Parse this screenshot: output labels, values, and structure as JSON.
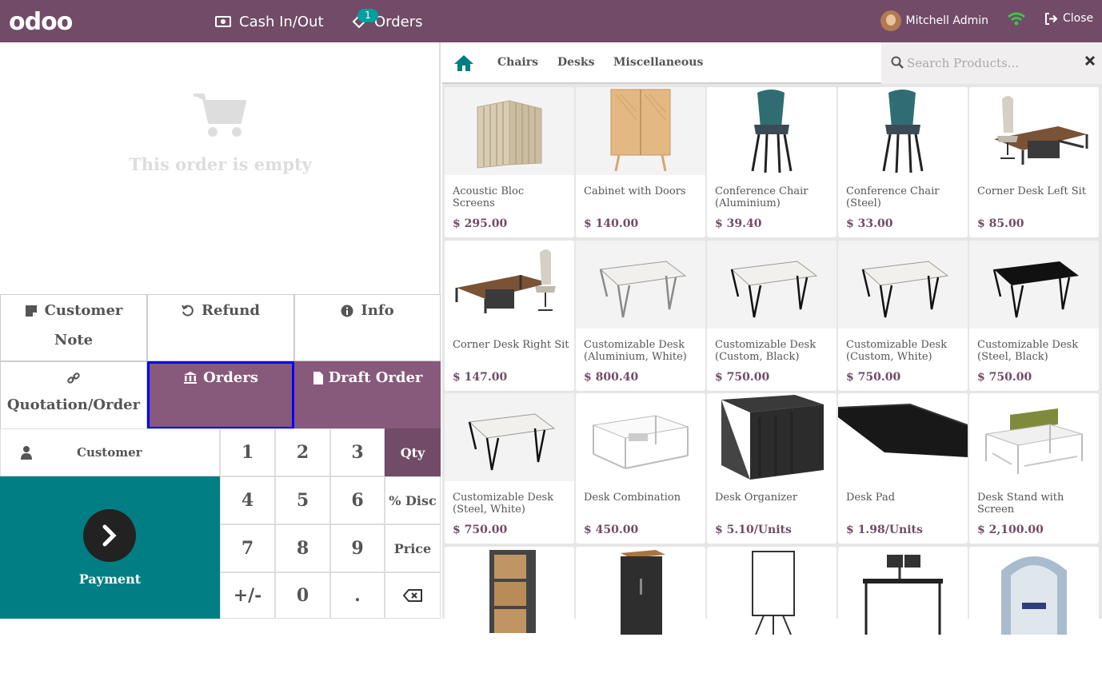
{
  "topbar": {
    "logo": "odoo",
    "cash_inout": "Cash In/Out",
    "orders": "Orders",
    "orders_badge": "1",
    "user": "Mitchell Admin",
    "close": "Close"
  },
  "order": {
    "empty_text": "This order is empty"
  },
  "controls": {
    "customer_note_line1": "Customer",
    "customer_note_line2": "Note",
    "refund": "Refund",
    "info": "Info",
    "quotation": "Quotation/Order",
    "orders": "Orders",
    "draft_order": "Draft Order"
  },
  "numpad": {
    "customer": "Customer",
    "keys": [
      "1",
      "2",
      "3",
      "4",
      "5",
      "6",
      "7",
      "8",
      "9",
      "+/-",
      "0",
      "."
    ],
    "qty": "Qty",
    "disc": "% Disc",
    "price": "Price",
    "payment": "Payment"
  },
  "categories": {
    "items": [
      "Chairs",
      "Desks",
      "Miscellaneous"
    ]
  },
  "search": {
    "placeholder": "Search Products..."
  },
  "products": [
    {
      "name": "Acoustic Bloc Screens",
      "price": "$ 295.00",
      "icon": "screen-panels"
    },
    {
      "name": "Cabinet with Doors",
      "price": "$ 140.00",
      "icon": "cabinet"
    },
    {
      "name": "Conference Chair (Aluminium)",
      "price": "$ 39.40",
      "icon": "chair"
    },
    {
      "name": "Conference Chair (Steel)",
      "price": "$ 33.00",
      "icon": "chair"
    },
    {
      "name": "Corner Desk Left Sit",
      "price": "$ 85.00",
      "icon": "office-desk"
    },
    {
      "name": "Corner Desk Right Sit",
      "price": "$ 147.00",
      "icon": "office-desk"
    },
    {
      "name": "Customizable Desk (Aluminium, White)",
      "price": "$ 800.40",
      "icon": "desk-white"
    },
    {
      "name": "Customizable Desk (Custom, Black)",
      "price": "$ 750.00",
      "icon": "desk-white"
    },
    {
      "name": "Customizable Desk (Custom, White)",
      "price": "$ 750.00",
      "icon": "desk-white"
    },
    {
      "name": "Customizable Desk (Steel, Black)",
      "price": "$ 750.00",
      "icon": "desk-black"
    },
    {
      "name": "Customizable Desk (Steel, White)",
      "price": "$ 750.00",
      "icon": "desk-white"
    },
    {
      "name": "Desk Combination",
      "price": "$ 450.00",
      "icon": "desk-combo"
    },
    {
      "name": "Desk Organizer",
      "price": "$ 5.10/Units",
      "icon": "organizer"
    },
    {
      "name": "Desk Pad",
      "price": "$ 1.98/Units",
      "icon": "desk-pad"
    },
    {
      "name": "Desk Stand with Screen",
      "price": "$ 2,100.00",
      "icon": "desk-stand"
    },
    {
      "name": "",
      "price": "",
      "icon": "drawer-unit"
    },
    {
      "name": "",
      "price": "",
      "icon": "pedestal"
    },
    {
      "name": "",
      "price": "",
      "icon": "flipchart"
    },
    {
      "name": "",
      "price": "",
      "icon": "monitor-desk"
    },
    {
      "name": "",
      "price": "",
      "icon": "booth"
    }
  ]
}
